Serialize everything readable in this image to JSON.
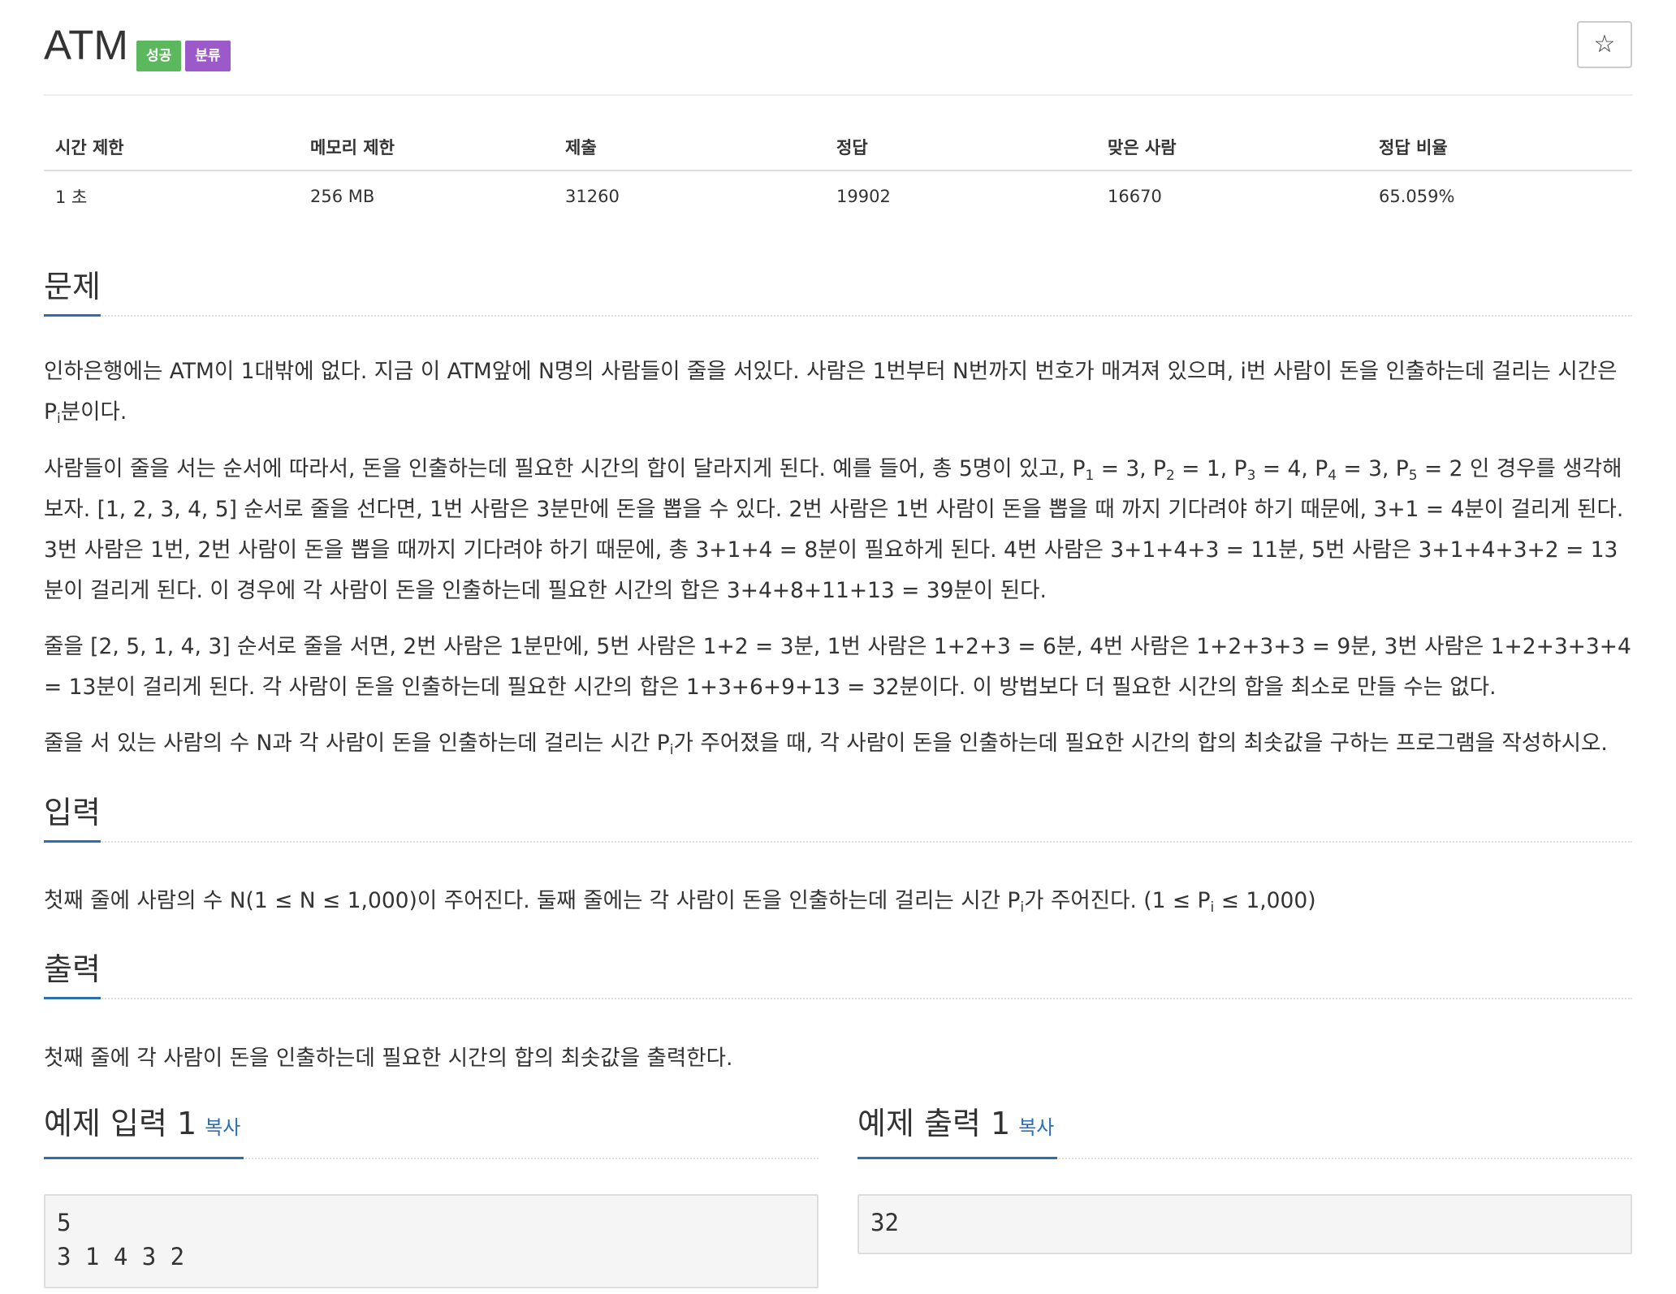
{
  "header": {
    "title": "ATM",
    "badge_success": "성공",
    "badge_class": "분류",
    "star_icon": "☆"
  },
  "info": {
    "headers": [
      "시간 제한",
      "메모리 제한",
      "제출",
      "정답",
      "맞은 사람",
      "정답 비율"
    ],
    "values": [
      "1 초",
      "256 MB",
      "31260",
      "19902",
      "16670",
      "65.059%"
    ]
  },
  "problem": {
    "heading": "문제",
    "p1_a": "인하은행에는 ATM이 1대밖에 없다. 지금 이 ATM앞에 N명의 사람들이 줄을 서있다. 사람은 1번부터 N번까지 번호가 매겨져 있으며, i번 사람이 돈을 인출하는데 걸리는 시간은 P",
    "p1_sub": "i",
    "p1_b": "분이다.",
    "p2_a": "사람들이 줄을 서는 순서에 따라서, 돈을 인출하는데 필요한 시간의 합이 달라지게 된다. 예를 들어, 총 5명이 있고, P",
    "p2_s1": "1",
    "p2_b": " = 3, P",
    "p2_s2": "2",
    "p2_c": " = 1, P",
    "p2_s3": "3",
    "p2_d": " = 4, P",
    "p2_s4": "4",
    "p2_e": " = 3, P",
    "p2_s5": "5",
    "p2_f": " = 2 인 경우를 생각해보자. [1, 2, 3, 4, 5] 순서로 줄을 선다면, 1번 사람은 3분만에 돈을 뽑을 수 있다. 2번 사람은 1번 사람이 돈을 뽑을 때 까지 기다려야 하기 때문에, 3+1 = 4분이 걸리게 된다. 3번 사람은 1번, 2번 사람이 돈을 뽑을 때까지 기다려야 하기 때문에, 총 3+1+4 = 8분이 필요하게 된다. 4번 사람은 3+1+4+3 = 11분, 5번 사람은 3+1+4+3+2 = 13분이 걸리게 된다. 이 경우에 각 사람이 돈을 인출하는데 필요한 시간의 합은 3+4+8+11+13 = 39분이 된다.",
    "p3": "줄을 [2, 5, 1, 4, 3] 순서로 줄을 서면, 2번 사람은 1분만에, 5번 사람은 1+2 = 3분, 1번 사람은 1+2+3 = 6분, 4번 사람은 1+2+3+3 = 9분, 3번 사람은 1+2+3+3+4 = 13분이 걸리게 된다. 각 사람이 돈을 인출하는데 필요한 시간의 합은 1+3+6+9+13 = 32분이다. 이 방법보다 더 필요한 시간의 합을 최소로 만들 수는 없다.",
    "p4_a": "줄을 서 있는 사람의 수 N과 각 사람이 돈을 인출하는데 걸리는 시간 P",
    "p4_sub": "i",
    "p4_b": "가 주어졌을 때, 각 사람이 돈을 인출하는데 필요한 시간의 합의 최솟값을 구하는 프로그램을 작성하시오."
  },
  "input": {
    "heading": "입력",
    "p_a": "첫째 줄에 사람의 수 N(1 ≤ N ≤ 1,000)이 주어진다. 둘째 줄에는 각 사람이 돈을 인출하는데 걸리는 시간 P",
    "p_sub1": "i",
    "p_b": "가 주어진다. (1 ≤ P",
    "p_sub2": "i",
    "p_c": " ≤ 1,000)"
  },
  "output": {
    "heading": "출력",
    "p": "첫째 줄에 각 사람이 돈을 인출하는데 필요한 시간의 합의 최솟값을 출력한다."
  },
  "samples": {
    "input_heading": "예제 입력 1",
    "output_heading": "예제 출력 1",
    "copy_label": "복사",
    "input_text": "5\n3 1 4 3 2",
    "output_text": "32"
  }
}
